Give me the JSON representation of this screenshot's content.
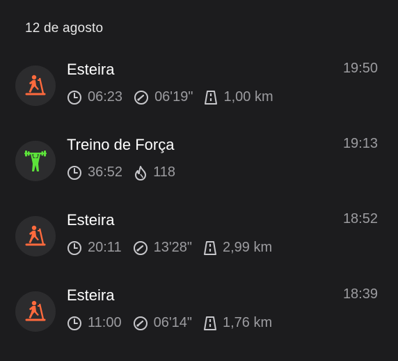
{
  "date_header": "12 de agosto",
  "workouts": [
    {
      "type_icon": "treadmill-icon",
      "title": "Esteira",
      "time": "19:50",
      "duration": "06:23",
      "pace": "06'19\"",
      "distance": "1,00 km",
      "accent": "#ff6a3d"
    },
    {
      "type_icon": "strength-training-icon",
      "title": "Treino de Força",
      "time": "19:13",
      "duration": "36:52",
      "calories": "118",
      "accent": "#5ce23a"
    },
    {
      "type_icon": "treadmill-icon",
      "title": "Esteira",
      "time": "18:52",
      "duration": "20:11",
      "pace": "13'28\"",
      "distance": "2,99 km",
      "accent": "#ff6a3d"
    },
    {
      "type_icon": "treadmill-icon",
      "title": "Esteira",
      "time": "18:39",
      "duration": "11:00",
      "pace": "06'14\"",
      "distance": "1,76 km",
      "accent": "#ff6a3d"
    }
  ],
  "metric_icons": {
    "duration": "clock-icon",
    "pace": "speedometer-icon",
    "distance": "road-icon",
    "calories": "flame-icon"
  }
}
